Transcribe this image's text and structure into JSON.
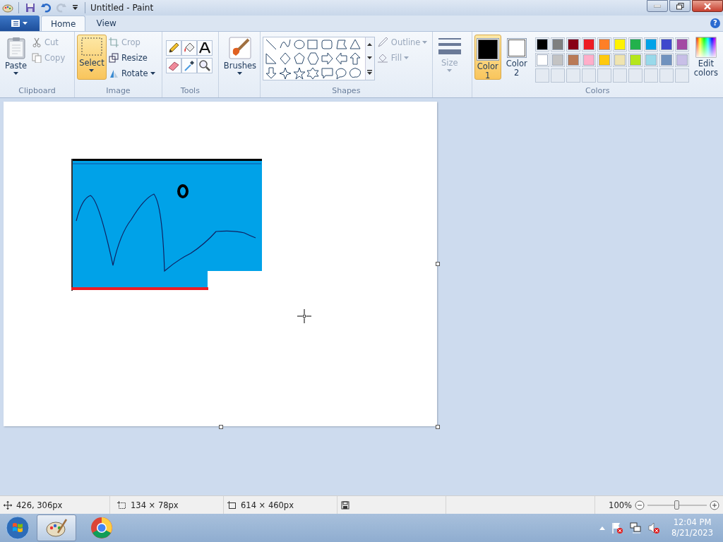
{
  "window": {
    "title": "Untitled - Paint"
  },
  "tabs": [
    {
      "label": "Home",
      "selected": true
    },
    {
      "label": "View",
      "selected": false
    }
  ],
  "help": "?",
  "clipboard": {
    "paste": "Paste",
    "cut": {
      "label": "Cut",
      "disabled": true
    },
    "copy": {
      "label": "Copy",
      "disabled": true
    },
    "label": "Clipboard"
  },
  "image": {
    "select": {
      "label": "Select",
      "selected": true
    },
    "crop": {
      "label": "Crop",
      "disabled": true
    },
    "resize": {
      "label": "Resize",
      "disabled": false
    },
    "rotate": {
      "label": "Rotate",
      "disabled": false
    },
    "label": "Image"
  },
  "tools": {
    "label": "Tools"
  },
  "brushes": {
    "label": "Brushes"
  },
  "shapes": {
    "label": "Shapes",
    "outline": {
      "label": "Outline",
      "disabled": true
    },
    "fill": {
      "label": "Fill",
      "disabled": true
    }
  },
  "size": {
    "label": "Size",
    "disabled": true
  },
  "colors": {
    "label": "Colors",
    "current": [
      {
        "label": "Color",
        "number": "1",
        "color": "#000000",
        "selected": true
      },
      {
        "label": "Color",
        "number": "2",
        "color": "#ffffff",
        "selected": false
      }
    ],
    "palette": [
      {
        "color": "#000000"
      },
      {
        "color": "#7f7f7f"
      },
      {
        "color": "#880015"
      },
      {
        "color": "#ed1c24"
      },
      {
        "color": "#ff7f27"
      },
      {
        "color": "#fff200"
      },
      {
        "color": "#22b14c"
      },
      {
        "color": "#00a2e8"
      },
      {
        "color": "#3f48cc"
      },
      {
        "color": "#a349a4"
      },
      {
        "color": "#ffffff"
      },
      {
        "color": "#c3c3c3"
      },
      {
        "color": "#b97a57"
      },
      {
        "color": "#ffaec9"
      },
      {
        "color": "#ffc90e"
      },
      {
        "color": "#efe4b0"
      },
      {
        "color": "#b5e61d"
      },
      {
        "color": "#99d9ea"
      },
      {
        "color": "#7092be"
      },
      {
        "color": "#c8bfe7"
      }
    ],
    "edit": [
      "Edit",
      "colors"
    ]
  },
  "status_bar": {
    "cursor": "426, 306px",
    "selection": "134 × 78px",
    "image_size": "614 × 460px",
    "zoom": "100%",
    "zoom_level": {
      "level": 0.5
    }
  },
  "taskbar": {
    "time": "12:04 PM",
    "date": "8/21/2023"
  }
}
